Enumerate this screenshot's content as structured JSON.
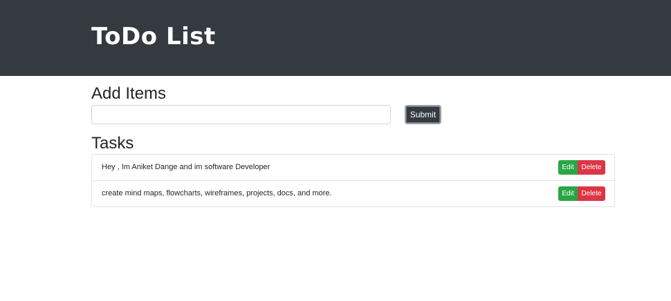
{
  "header": {
    "title": "ToDo List"
  },
  "add_section": {
    "title": "Add Items",
    "input_value": "",
    "submit_label": "Submit"
  },
  "tasks_section": {
    "title": "Tasks",
    "items": [
      {
        "text": "Hey , Im Aniket Dange and im software Developer",
        "edit_label": "Edit",
        "delete_label": "Delete"
      },
      {
        "text": "create mind maps, flowcharts, wireframes, projects, docs, and more.",
        "edit_label": "Edit",
        "delete_label": "Delete"
      }
    ]
  },
  "colors": {
    "header_bg": "#343a40",
    "edit": "#28a745",
    "delete": "#dc3545"
  }
}
